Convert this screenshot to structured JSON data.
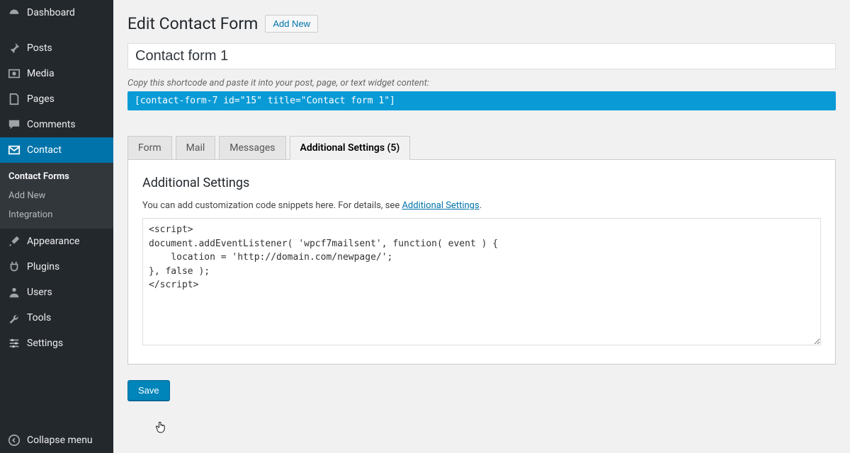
{
  "sidebar": {
    "items": [
      {
        "label": "Dashboard",
        "icon": "dashboard"
      },
      {
        "label": "Posts",
        "icon": "pin"
      },
      {
        "label": "Media",
        "icon": "media"
      },
      {
        "label": "Pages",
        "icon": "page"
      },
      {
        "label": "Comments",
        "icon": "comment"
      },
      {
        "label": "Contact",
        "icon": "mail"
      },
      {
        "label": "Appearance",
        "icon": "brush"
      },
      {
        "label": "Plugins",
        "icon": "plug"
      },
      {
        "label": "Users",
        "icon": "user"
      },
      {
        "label": "Tools",
        "icon": "wrench"
      },
      {
        "label": "Settings",
        "icon": "sliders"
      }
    ],
    "submenu": {
      "items": [
        "Contact Forms",
        "Add New",
        "Integration"
      ],
      "active_index": 0
    },
    "collapse_label": "Collapse menu"
  },
  "header": {
    "title": "Edit Contact Form",
    "add_new_label": "Add New"
  },
  "form": {
    "title_value": "Contact form 1",
    "shortcode_hint": "Copy this shortcode and paste it into your post, page, or text widget content:",
    "shortcode": "[contact-form-7 id=\"15\" title=\"Contact form 1\"]"
  },
  "tabs": [
    "Form",
    "Mail",
    "Messages",
    "Additional Settings (5)"
  ],
  "active_tab_index": 3,
  "panel": {
    "heading": "Additional Settings",
    "intro_prefix": "You can add customization code snippets here. For details, see ",
    "intro_link": "Additional Settings",
    "intro_suffix": ".",
    "textarea_value": "<script>\ndocument.addEventListener( 'wpcf7mailsent', function( event ) {\n    location = 'http://domain.com/newpage/';\n}, false );\n</script>"
  },
  "save_label": "Save"
}
